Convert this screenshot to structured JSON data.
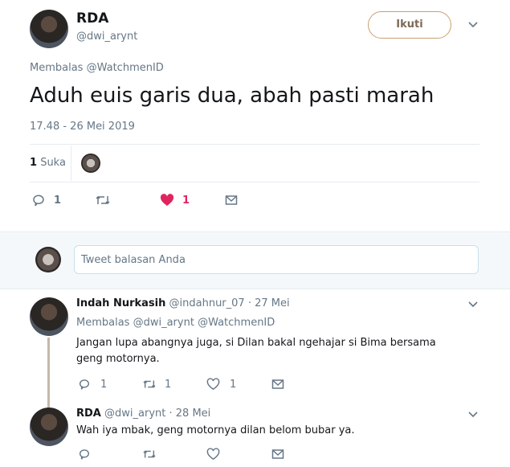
{
  "main_tweet": {
    "display_name": "RDA",
    "handle": "@dwi_arynt",
    "follow_label": "Ikuti",
    "replying_prefix": "Membalas",
    "replying_to": "@WatchmenID",
    "text": "Aduh euis garis dua, abah pasti marah",
    "timestamp": "17.48 - 26 Mei 2019",
    "likes_count": "1",
    "likes_label": "Suka",
    "actions": {
      "reply_count": "1",
      "retweet_count": "",
      "like_count": "1"
    }
  },
  "reply_box": {
    "placeholder": "Tweet balasan Anda"
  },
  "replies": [
    {
      "display_name": "Indah Nurkasih",
      "handle": "@indahnur_07",
      "date": "· 27 Mei",
      "replying_prefix": "Membalas",
      "replying_to": "@dwi_arynt @WatchmenID",
      "text": "Jangan lupa abangnya juga, si Dilan bakal ngehajar si Bima bersama geng motornya.",
      "reply_count": "1",
      "retweet_count": "1",
      "like_count": "1"
    },
    {
      "display_name": "RDA",
      "handle": "@dwi_arynt",
      "date": "· 28 Mei",
      "text": "Wah iya mbak, geng motornya dilan belom bubar ya.",
      "reply_count": "",
      "retweet_count": "",
      "like_count": ""
    }
  ],
  "colors": {
    "like_red": "#e0245e",
    "muted": "#657786",
    "accent": "#1da1f2",
    "separator": "#e6ecf0",
    "reply_bg": "#f5f8fa"
  }
}
